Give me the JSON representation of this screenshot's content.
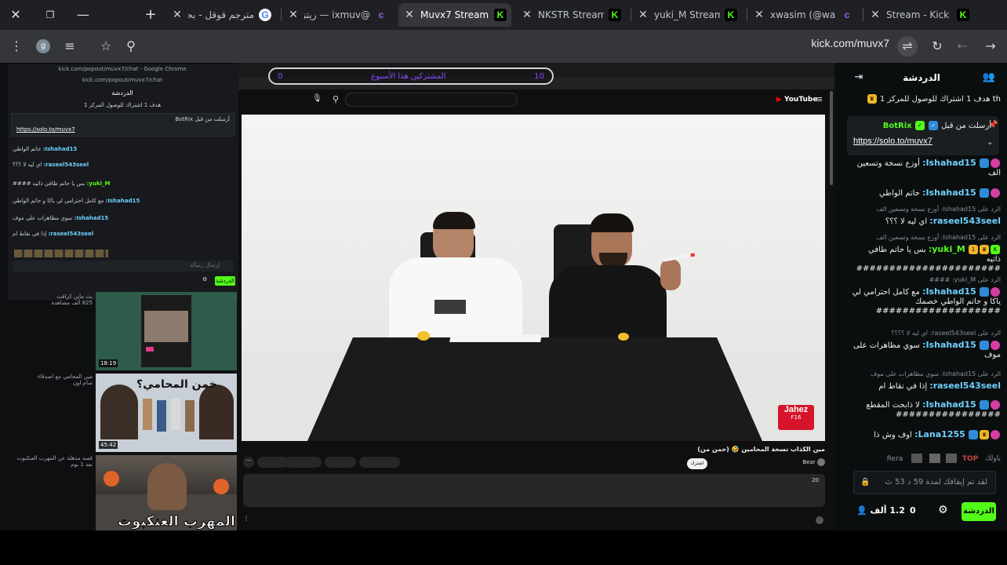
{
  "tabs": [
    {
      "title": "مترجم قوقل - بحث",
      "favicon": "google-icon",
      "active": false
    },
    {
      "title": "@ixmuv — ريتزز",
      "favicon": "kaw-icon",
      "active": false
    },
    {
      "title": "Muvx7 Stream",
      "favicon": "kick-icon",
      "active": true
    },
    {
      "title": "NKSTR Stream",
      "favicon": "kick-icon",
      "active": false
    },
    {
      "title": "yuki_M Stream -",
      "favicon": "kick-icon",
      "active": false
    },
    {
      "title": "xwasim (@was)",
      "favicon": "kaw-icon",
      "active": false
    },
    {
      "title": "Stream - Kick Da",
      "favicon": "kick-icon",
      "active": false
    }
  ],
  "toolbar": {
    "url": "kick.com/muvx7",
    "avatar_letter": "g"
  },
  "overlay": {
    "left_number": "0",
    "text": "المشتركين هذا الأسبوع",
    "right_number": "10"
  },
  "mini_chat": {
    "url": "kick.com/popout/muvx7/chat - Google Chrome",
    "url2": "kick.com/popout/muvx7/chat",
    "header": "الدردشة",
    "goal": "هدف 1 اشتراك للوصول المركز 1",
    "pinned_by": "أرسلت من قبل BotRix",
    "pinned_link": "https://solo.to/muvx7",
    "rows": [
      {
        "user": "Ishahad15:",
        "text": "حاتم الواطي"
      },
      {
        "user": "raseel543seel:",
        "text": "اي ليه لا ؟؟؟"
      },
      {
        "user": "yuki_M:",
        "text": "بس يا حاتم طافي ذاتيه ####"
      },
      {
        "user": "Ishahad15:",
        "text": "مع كامل احترامي لي ياكا و حاتم الواطي"
      },
      {
        "user": "Ishahad15:",
        "text": "سوي مظاهرات على موف"
      },
      {
        "user": "raseel543seel:",
        "text": "إذا في نقاط ام"
      }
    ],
    "input_placeholder": "إرسال رسالة",
    "send_label": "الدردشة"
  },
  "sidebar_videos": [
    {
      "title": "بث ماين كرافت",
      "meta": "825 ألف مشاهدة",
      "duration": "18:19"
    },
    {
      "title": "مين المحامي مع اصدقاء",
      "meta": "سام اون",
      "duration": "45:42",
      "thumb_text": "خمن المحامي؟"
    },
    {
      "title": "قصة مذهلة عن المهرب العنكبوت",
      "meta": "بعد 1 يوم",
      "duration": "",
      "thumb_text": "المهرب العنكبوت"
    }
  ],
  "youtube": {
    "video_title": "مين الكذاب نسخة المحامين 🤣 (خمن من)",
    "channel": "Bear",
    "subscribe": "اشترك",
    "likes": "",
    "watermark_brand": "Jahez",
    "watermark_sub": "F16",
    "comment_count": "20",
    "search_placeholder": ""
  },
  "chat": {
    "header": "الدردشة",
    "goal": "هدف 1 اشتراك للوصول للمركز 1",
    "goal_badge": "th",
    "pinned": {
      "by": "أرسلت من قبل",
      "bot_name": "BotRix",
      "link": "https://solo.to/muvx7"
    },
    "messages": [
      {
        "reply": "",
        "user": "Ishahad15:",
        "text": "أوزع نسخة وتسعين الف",
        "color": "#6fd0ff",
        "badges": [
          "b-pink",
          "b-blue"
        ]
      },
      {
        "reply": "",
        "user": "Ishahad15:",
        "text": "حاتم الواطي",
        "color": "#6fd0ff",
        "badges": [
          "b-pink",
          "b-blue"
        ]
      },
      {
        "reply": "الرد على Ishahad15: أوزع نسخة وتسعين الف",
        "user": "raseel543seel:",
        "text": "اي ليه لا ؟؟؟",
        "color": "#6fd0ff",
        "badges": []
      },
      {
        "reply": "الرد على Ishahad15: أوزع نسخة وتسعين الف",
        "user": "yuki_M:",
        "text": "بس يا حاتم طافي ذاتيه ######################",
        "color": "#53fc18",
        "badges": [
          "b-green",
          "b-gold",
          "b-gold"
        ]
      },
      {
        "reply": "الرد على yuki_M: ####",
        "user": "Ishahad15:",
        "text": "مع كامل احترامي لي ياكا و حاتم الواطي خصمك ###################",
        "color": "#6fd0ff",
        "badges": [
          "b-pink",
          "b-blue"
        ]
      },
      {
        "reply": "الرد على raseel543seel: اي ليه لا ؟؟؟؟",
        "user": "Ishahad15:",
        "text": "سوي مظاهرات على موف",
        "color": "#6fd0ff",
        "badges": [
          "b-pink",
          "b-blue"
        ]
      },
      {
        "reply": "الرد على Ishahad15: سوي مظاهرات على موف",
        "user": "raseel543seel:",
        "text": "إذا في نقاط ام",
        "color": "#6fd0ff",
        "badges": []
      },
      {
        "reply": "",
        "user": "Ishahad15:",
        "text": "لا ذابحت المقطع ################",
        "color": "#6fd0ff",
        "badges": [
          "b-pink",
          "b-blue"
        ]
      },
      {
        "reply": "",
        "user": "Lana1255:",
        "text": "اوف وش ذا",
        "color": "#6fd0ff",
        "badges": [
          "b-pink",
          "b-gold",
          "b-blue"
        ]
      }
    ],
    "emote_labels": [
      "باولك",
      "Rera",
      "TOP"
    ],
    "input_placeholder": "لقد تم إيقافك لمدة 59 د 53 ث",
    "viewers": "1.2 ألف",
    "counter": "0",
    "send_label": "الدردشة"
  }
}
